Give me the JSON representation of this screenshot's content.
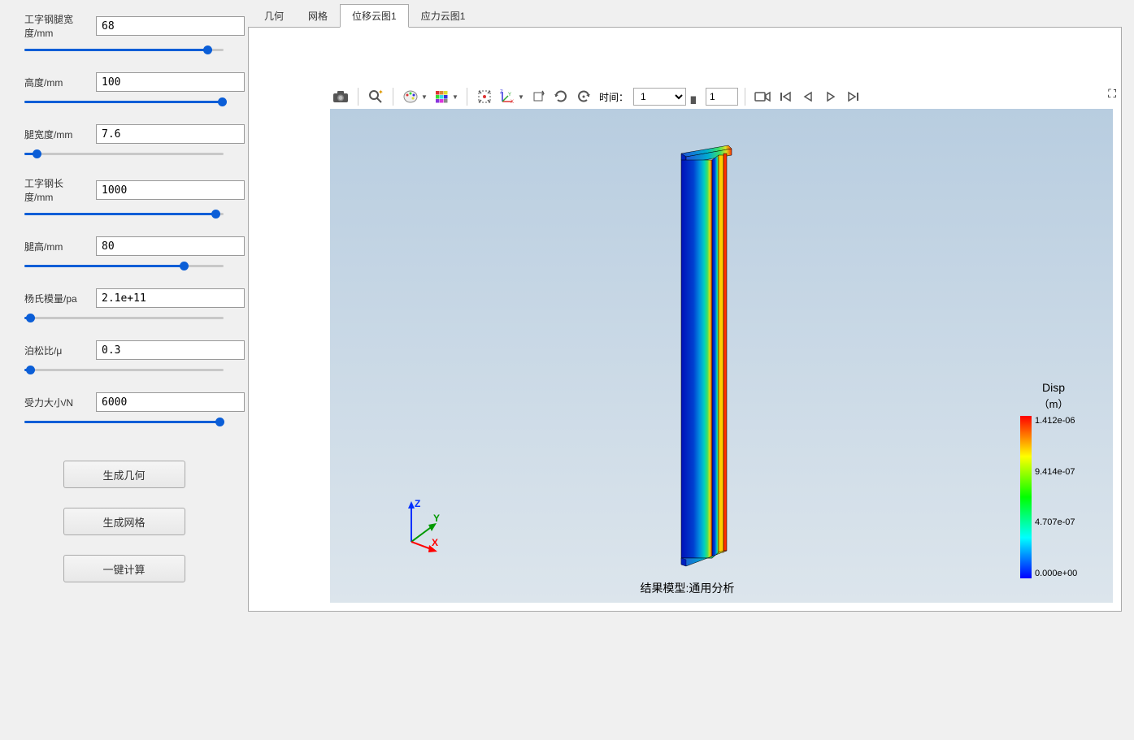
{
  "sidebar": {
    "params": [
      {
        "label": "工字钢腿宽度/mm",
        "value": "68",
        "pct": 92
      },
      {
        "label": "高度/mm",
        "value": "100",
        "pct": 99
      },
      {
        "label": "腿宽度/mm",
        "value": "7.6",
        "pct": 6
      },
      {
        "label": "工字钢长度/mm",
        "value": "1000",
        "pct": 96
      },
      {
        "label": "腿高/mm",
        "value": "80",
        "pct": 80
      },
      {
        "label": "杨氏模量/pa",
        "value": "2.1e+11",
        "pct": 3
      },
      {
        "label": "泊松比/μ",
        "value": "0.3",
        "pct": 3
      },
      {
        "label": "受力大小/N",
        "value": "6000",
        "pct": 98
      }
    ],
    "buttons": {
      "gen_geometry": "生成几何",
      "gen_mesh": "生成网格",
      "compute": "一键计算"
    }
  },
  "tabs": {
    "items": [
      "几何",
      "网格",
      "位移云图1",
      "应力云图1"
    ],
    "active": 2
  },
  "toolbar": {
    "time_label": "时间：",
    "time_value": "1",
    "step_value": "1"
  },
  "viewport": {
    "model_label": "结果模型:通用分析",
    "triad": {
      "x": "X",
      "y": "Y",
      "z": "Z"
    }
  },
  "legend": {
    "title": "Disp",
    "unit": "（m）",
    "labels": [
      "1.412e-06",
      "9.414e-07",
      "4.707e-07",
      "0.000e+00"
    ]
  }
}
